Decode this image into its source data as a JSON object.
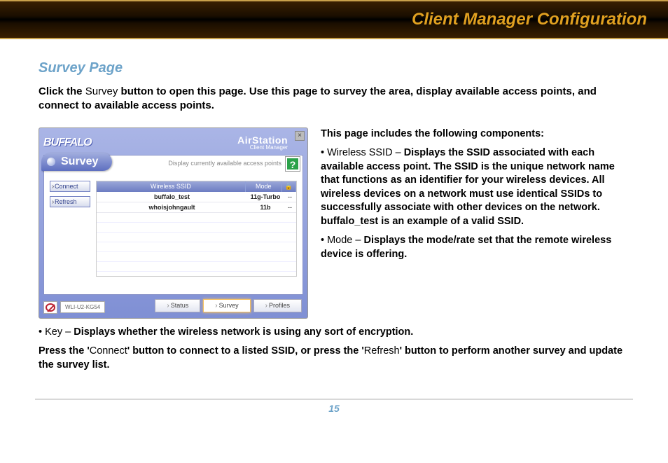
{
  "header": {
    "title": "Client Manager Configuration"
  },
  "section": {
    "title": "Survey Page"
  },
  "intro": {
    "pre": "Click the ",
    "survey_label": "Survey",
    "post": " button to open this page. Use this page to survey the area, display available access points, and connect to available access points."
  },
  "app": {
    "brand": "BUFFALO",
    "subbrand": "AirStation",
    "subbrand2": "Client Manager",
    "close": "×",
    "tab": "Survey",
    "hint": "Display currently available access points",
    "help": "?",
    "buttons": {
      "connect": "Connect",
      "refresh": "Refresh"
    },
    "columns": {
      "ssid": "Wireless SSID",
      "mode": "Mode",
      "key": "🔒"
    },
    "rows": [
      {
        "ssid": "buffalo_test",
        "mode": "11g-Turbo",
        "key": "--"
      },
      {
        "ssid": "whoisjohngault",
        "mode": "11b",
        "key": "--"
      }
    ],
    "bottom_tabs": {
      "status": "Status",
      "survey": "Survey",
      "profiles": "Profiles"
    },
    "device": "WLI-U2-KG54"
  },
  "notes": {
    "components_intro": "This page includes the following components:",
    "ssid_label": "• Wireless SSID – ",
    "ssid_body": "Displays the SSID associated with each available access point. The SSID is the unique network name that functions as an identifier for your wireless devices. All wireless devices on a network must use identical SSIDs to successfully associate with other devices on the network. buffalo_test is an example of a valid SSID.",
    "mode_label": "• Mode – ",
    "mode_body": "Displays the mode/rate set that the remote wireless device is offering.",
    "key_label": "• Key – ",
    "key_body": "Displays whether the wireless network is using any sort of encryption.",
    "press_pre": "Press the '",
    "press_connect": "Connect",
    "press_mid": "' button to connect to a listed SSID, or press the '",
    "press_refresh": "Refresh",
    "press_post": "' button to perform another survey and update the survey list."
  },
  "page_number": "15"
}
